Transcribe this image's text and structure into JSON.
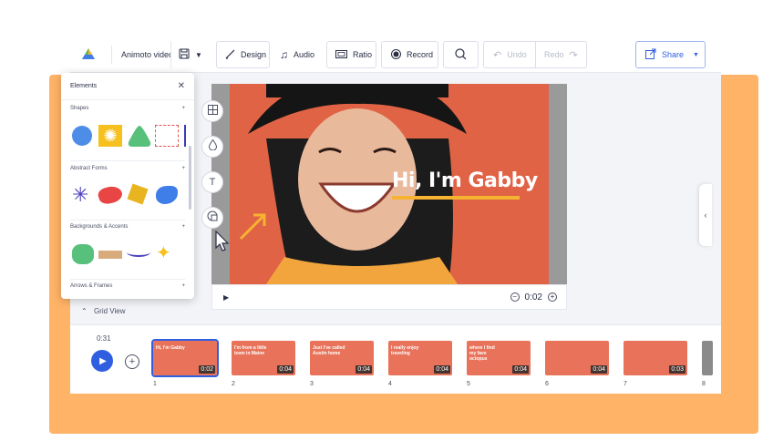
{
  "colors": {
    "accent_orange": "#ffb366",
    "brand_blue": "#2f5fe0",
    "play_blue": "#2f5fe0",
    "slide_orange": "#e8735a"
  },
  "toolbar": {
    "project_title": "Animoto video",
    "design_label": "Design",
    "audio_label": "Audio",
    "ratio_label": "Ratio",
    "record_label": "Record",
    "undo_label": "Undo",
    "redo_label": "Redo",
    "share_label": "Share"
  },
  "canvas": {
    "headline": "Hi, I'm Gabby",
    "time": "0:02"
  },
  "elements_panel": {
    "title": "Elements",
    "sections": [
      {
        "label": "Shapes"
      },
      {
        "label": "Abstract Forms"
      },
      {
        "label": "Backgrounds & Accents"
      },
      {
        "label": "Arrows & Frames"
      }
    ]
  },
  "grid_view": {
    "label": "Grid View"
  },
  "timeline": {
    "total_time": "0:31",
    "slides": [
      {
        "num": "1",
        "duration": "0:02",
        "caption": "Hi, I'm Gabby"
      },
      {
        "num": "2",
        "duration": "0:04",
        "caption": "I'm from a little town in Maine"
      },
      {
        "num": "3",
        "duration": "0:04",
        "caption": "Just I've called Austin home"
      },
      {
        "num": "4",
        "duration": "0:04",
        "caption": "I really enjoy traveling"
      },
      {
        "num": "5",
        "duration": "0:04",
        "caption": "where I find my fave octopus"
      },
      {
        "num": "6",
        "duration": "0:04",
        "caption": ""
      },
      {
        "num": "7",
        "duration": "0:03",
        "caption": ""
      },
      {
        "num": "8",
        "duration": "",
        "caption": ""
      }
    ]
  }
}
